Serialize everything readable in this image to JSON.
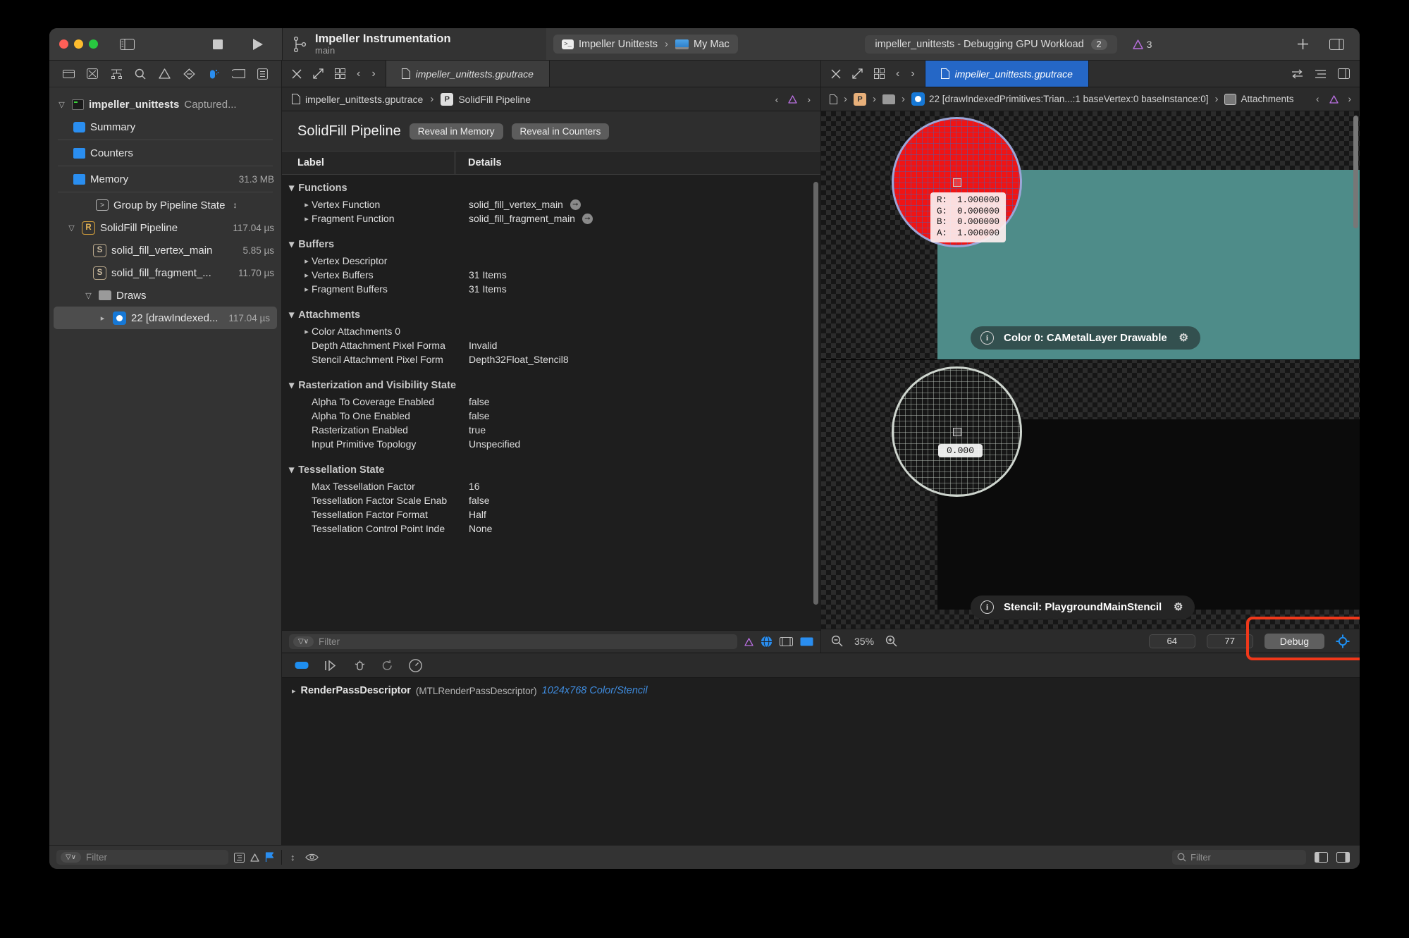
{
  "window": {
    "traffic_lights": [
      "close",
      "minimize",
      "zoom"
    ],
    "project": {
      "title": "Impeller Instrumentation",
      "branch": "main"
    },
    "scheme": {
      "target": "Impeller Unittests",
      "device": "My Mac"
    },
    "status": {
      "text": "impeller_unittests - Debugging GPU Workload",
      "count": "2",
      "warnings": "3"
    }
  },
  "navigator": {
    "toolbar_icons": [
      "folder-icon",
      "source-control-icon",
      "symbol-icon",
      "search-icon",
      "warning-icon",
      "test-icon",
      "debug-icon",
      "breakpoint-icon",
      "report-icon"
    ],
    "tree": [
      {
        "label": "impeller_unittests",
        "suffix": "Captured...",
        "icon": "terminal-icon",
        "twisty": "open",
        "indent": 0,
        "time": ""
      },
      {
        "label": "Summary",
        "suffix": "",
        "icon": "document-icon",
        "twisty": "",
        "indent": 1,
        "time": ""
      },
      {
        "label": "Counters",
        "suffix": "",
        "icon": "chip-icon",
        "twisty": "",
        "indent": 1,
        "time": ""
      },
      {
        "label": "Memory",
        "suffix": "",
        "icon": "chip-icon",
        "twisty": "",
        "indent": 1,
        "time": "31.3 MB"
      },
      {
        "label": "Group by Pipeline State",
        "suffix": "",
        "icon": "group-icon",
        "twisty": "",
        "indent": 2,
        "time": ""
      },
      {
        "label": "SolidFill Pipeline",
        "suffix": "",
        "icon": "badge-R",
        "twisty": "open",
        "indent": 1,
        "time": "117.04 µs"
      },
      {
        "label": "solid_fill_vertex_main",
        "suffix": "",
        "icon": "badge-S",
        "twisty": "",
        "indent": 2,
        "time": "5.85 µs"
      },
      {
        "label": "solid_fill_fragment_...",
        "suffix": "",
        "icon": "badge-S",
        "twisty": "",
        "indent": 2,
        "time": "11.70 µs"
      },
      {
        "label": "Draws",
        "suffix": "",
        "icon": "folder-icon",
        "twisty": "open",
        "indent": 2,
        "time": ""
      },
      {
        "label": "22 [drawIndexed...",
        "suffix": "",
        "icon": "draw-icon",
        "twisty": "closed",
        "indent": 3,
        "time": "117.04 µs",
        "selected": true
      }
    ],
    "filter_placeholder": "Filter"
  },
  "detail_pane": {
    "tab_label": "impeller_unittests.gputrace",
    "breadcrumb": [
      {
        "label": "impeller_unittests.gputrace",
        "icon": "document-icon"
      },
      {
        "label": "SolidFill Pipeline",
        "icon": "badge-P"
      }
    ],
    "header": {
      "title": "SolidFill Pipeline",
      "buttons": [
        "Reveal in Memory",
        "Reveal in Counters"
      ]
    },
    "columns": [
      "Label",
      "Details"
    ],
    "groups": [
      {
        "name": "Functions",
        "rows": [
          {
            "label": "Vertex Function",
            "value": "solid_fill_vertex_main",
            "disclosure": true,
            "jump": true
          },
          {
            "label": "Fragment Function",
            "value": "solid_fill_fragment_main",
            "disclosure": true,
            "jump": true
          }
        ]
      },
      {
        "name": "Buffers",
        "rows": [
          {
            "label": "Vertex Descriptor",
            "value": "",
            "disclosure": true,
            "jump": false
          },
          {
            "label": "Vertex Buffers",
            "value": "31 Items",
            "disclosure": true,
            "jump": false
          },
          {
            "label": "Fragment Buffers",
            "value": "31 Items",
            "disclosure": true,
            "jump": false
          }
        ]
      },
      {
        "name": "Attachments",
        "rows": [
          {
            "label": "Color Attachments 0",
            "value": "",
            "disclosure": true,
            "jump": false
          },
          {
            "label": "Depth Attachment Pixel Forma",
            "value": "Invalid",
            "disclosure": false,
            "jump": false
          },
          {
            "label": "Stencil Attachment Pixel Form",
            "value": "Depth32Float_Stencil8",
            "disclosure": false,
            "jump": false
          }
        ]
      },
      {
        "name": "Rasterization and Visibility State",
        "rows": [
          {
            "label": "Alpha To Coverage Enabled",
            "value": "false",
            "disclosure": false,
            "jump": false
          },
          {
            "label": "Alpha To One Enabled",
            "value": "false",
            "disclosure": false,
            "jump": false
          },
          {
            "label": "Rasterization Enabled",
            "value": "true",
            "disclosure": false,
            "jump": false
          },
          {
            "label": "Input Primitive Topology",
            "value": "Unspecified",
            "disclosure": false,
            "jump": false
          }
        ]
      },
      {
        "name": "Tessellation State",
        "rows": [
          {
            "label": "Max Tessellation Factor",
            "value": "16",
            "disclosure": false,
            "jump": false
          },
          {
            "label": "Tessellation Factor Scale Enab",
            "value": "false",
            "disclosure": false,
            "jump": false
          },
          {
            "label": "Tessellation Factor Format",
            "value": "Half",
            "disclosure": false,
            "jump": false
          },
          {
            "label": "Tessellation Control Point Inde",
            "value": "None",
            "disclosure": false,
            "jump": false
          }
        ]
      }
    ],
    "filter_placeholder": "Filter"
  },
  "preview": {
    "tab_label": "impeller_unittests.gputrace",
    "breadcrumb": [
      {
        "label": "22 [drawIndexedPrimitives:Trian...:1 baseVertex:0 baseInstance:0]",
        "icon": "draw-icon"
      },
      {
        "label": "Attachments",
        "icon": "attachments-icon"
      }
    ],
    "color_attachment": {
      "chip_label": "Color 0: CAMetalLayer Drawable",
      "pixel_values": {
        "R": "1.000000",
        "G": "0.000000",
        "B": "0.000000",
        "A": "1.000000"
      }
    },
    "stencil_attachment": {
      "chip_label": "Stencil: PlaygroundMainStencil",
      "pixel_value": "0.000"
    },
    "bottom_bar": {
      "zoom": "35%",
      "coord_x": "64",
      "coord_y": "77",
      "debug_label": "Debug"
    }
  },
  "console": {
    "line": {
      "name": "RenderPassDescriptor",
      "type": "(MTLRenderPassDescriptor)",
      "size": "1024x768 Color/Stencil"
    },
    "filter_placeholder": "Filter"
  }
}
